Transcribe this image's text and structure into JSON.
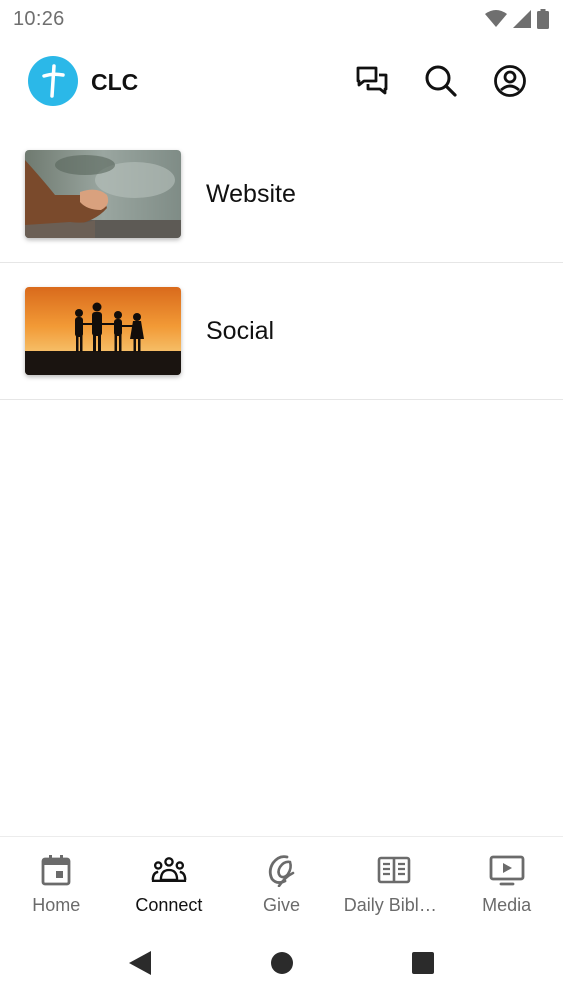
{
  "status_bar": {
    "time": "10:26"
  },
  "header": {
    "app_name": "CLC",
    "actions": [
      {
        "icon": "chat-icon"
      },
      {
        "icon": "search-icon"
      },
      {
        "icon": "account-icon"
      }
    ]
  },
  "list": {
    "items": [
      {
        "label": "Website",
        "thumbnail": "praying-hands-image"
      },
      {
        "label": "Social",
        "thumbnail": "family-sunset-silhouette-image"
      }
    ]
  },
  "bottom_nav": {
    "active": "Connect",
    "items": [
      {
        "label": "Home",
        "icon": "calendar-icon"
      },
      {
        "label": "Connect",
        "icon": "people-group-icon"
      },
      {
        "label": "Give",
        "icon": "give-icon"
      },
      {
        "label": "Daily Bible ...",
        "icon": "open-book-icon"
      },
      {
        "label": "Media",
        "icon": "play-screen-icon"
      }
    ]
  },
  "colors": {
    "brand": "#2bb8e8",
    "active_nav": "#111111",
    "inactive_nav": "#6b6b6b"
  }
}
